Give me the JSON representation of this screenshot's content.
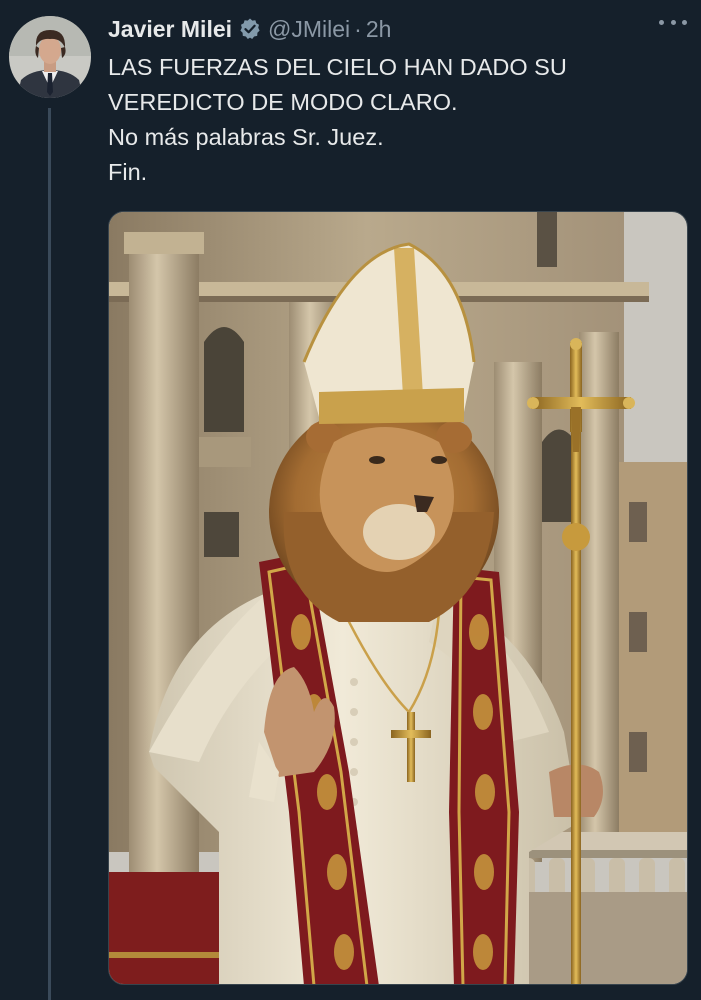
{
  "author": {
    "name": "Javier Milei",
    "handle": "@JMilei",
    "separator": "·",
    "time": "2h",
    "verified": true
  },
  "tweet": {
    "lines": [
      "LAS FUERZAS DEL CIELO HAN DADO SU",
      "VEREDICTO DE MODO CLARO.",
      "No más palabras Sr. Juez.",
      "Fin."
    ]
  },
  "icons": {
    "verified": "verified-badge-icon",
    "more": "more-options-icon"
  },
  "colors": {
    "background": "#15202b",
    "primary_text": "#e7e9ea",
    "secondary_text": "#8b98a5",
    "verified_badge": "#829aab"
  }
}
